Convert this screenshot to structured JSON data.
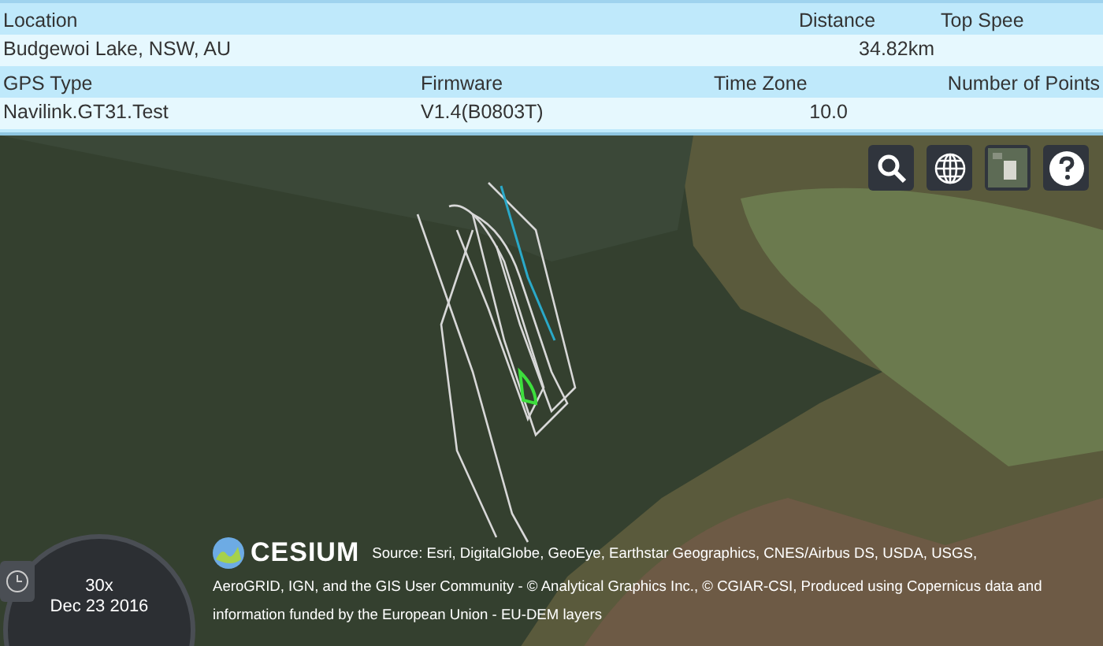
{
  "info_rows": [
    {
      "labels": [
        "Location",
        "Distance",
        "Top Spee"
      ],
      "values": [
        "Budgewoi Lake, NSW, AU",
        "34.82km"
      ]
    },
    {
      "labels": [
        "GPS Type",
        "Firmware",
        "Time Zone",
        "Number of Points"
      ],
      "values": [
        "Navilink.GT31.Test",
        "V1.4(B0803T)",
        "10.0"
      ]
    }
  ],
  "map": {
    "logo_text": "CESIUM",
    "credit_lines": [
      "Source: Esri, DigitalGlobe, GeoEye, Earthstar Geographics, CNES/Airbus DS, USDA, USGS,",
      "AeroGRID, IGN, and the GIS User Community - © Analytical Graphics Inc., © CGIAR-CSI, Produced using Copernicus data and",
      "information funded by the European Union - EU-DEM layers"
    ],
    "clock": {
      "speed": "30x",
      "date": "Dec 23 2016"
    }
  }
}
